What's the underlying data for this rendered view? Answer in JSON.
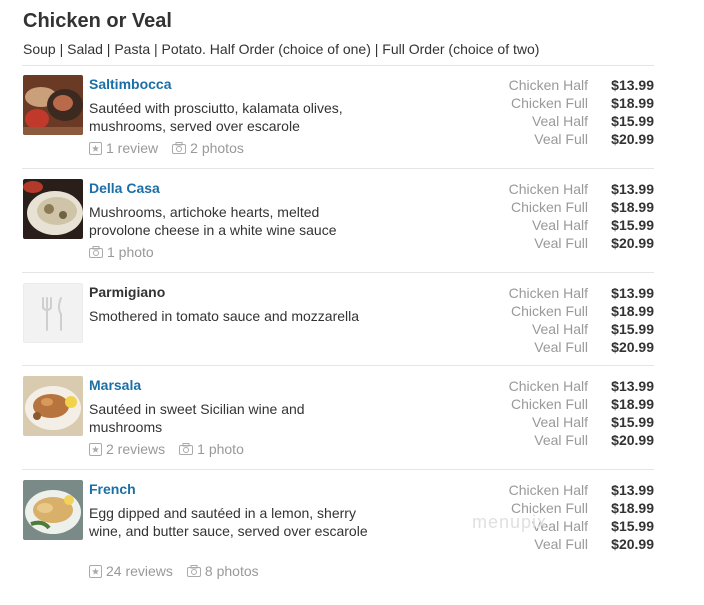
{
  "page": {
    "title": "Chicken or Veal",
    "subtitle": "Soup | Salad | Pasta | Potato. Half Order (choice of one) | Full Order (choice of two)"
  },
  "items": [
    {
      "name": "Saltimbocca",
      "description": "Sautéed with prosciutto, kalamata olives, mushrooms, served over escarole",
      "reviews": "1 review",
      "photos": "2 photos",
      "prices": [
        {
          "label": "Chicken Half",
          "value": "$13.99"
        },
        {
          "label": "Chicken Full",
          "value": "$18.99"
        },
        {
          "label": "Veal Half",
          "value": "$15.99"
        },
        {
          "label": "Veal Full",
          "value": "$20.99"
        }
      ]
    },
    {
      "name": "Della Casa",
      "description": "Mushrooms, artichoke hearts, melted provolone cheese in a white wine sauce",
      "photos": "1 photo",
      "prices": [
        {
          "label": "Chicken Half",
          "value": "$13.99"
        },
        {
          "label": "Chicken Full",
          "value": "$18.99"
        },
        {
          "label": "Veal Half",
          "value": "$15.99"
        },
        {
          "label": "Veal Full",
          "value": "$20.99"
        }
      ]
    },
    {
      "name": "Parmigiano",
      "description": "Smothered in tomato sauce and mozzarella",
      "prices": [
        {
          "label": "Chicken Half",
          "value": "$13.99"
        },
        {
          "label": "Chicken Full",
          "value": "$18.99"
        },
        {
          "label": "Veal Half",
          "value": "$15.99"
        },
        {
          "label": "Veal Full",
          "value": "$20.99"
        }
      ]
    },
    {
      "name": "Marsala",
      "description": "Sautéed in sweet Sicilian wine and mushrooms",
      "reviews": "2 reviews",
      "photos": "1 photo",
      "prices": [
        {
          "label": "Chicken Half",
          "value": "$13.99"
        },
        {
          "label": "Chicken Full",
          "value": "$18.99"
        },
        {
          "label": "Veal Half",
          "value": "$15.99"
        },
        {
          "label": "Veal Full",
          "value": "$20.99"
        }
      ]
    },
    {
      "name": "French",
      "description": "Egg dipped and sautéed in a lemon, sherry wine, and butter sauce, served over escarole",
      "reviews": "24 reviews",
      "photos": "8 photos",
      "prices": [
        {
          "label": "Chicken Half",
          "value": "$13.99"
        },
        {
          "label": "Chicken Full",
          "value": "$18.99"
        },
        {
          "label": "Veal Half",
          "value": "$15.99"
        },
        {
          "label": "Veal Full",
          "value": "$20.99"
        }
      ]
    }
  ],
  "watermark": "menupix",
  "colors": {
    "link": "#1a6fa6",
    "muted": "#999999",
    "text": "#333333"
  }
}
